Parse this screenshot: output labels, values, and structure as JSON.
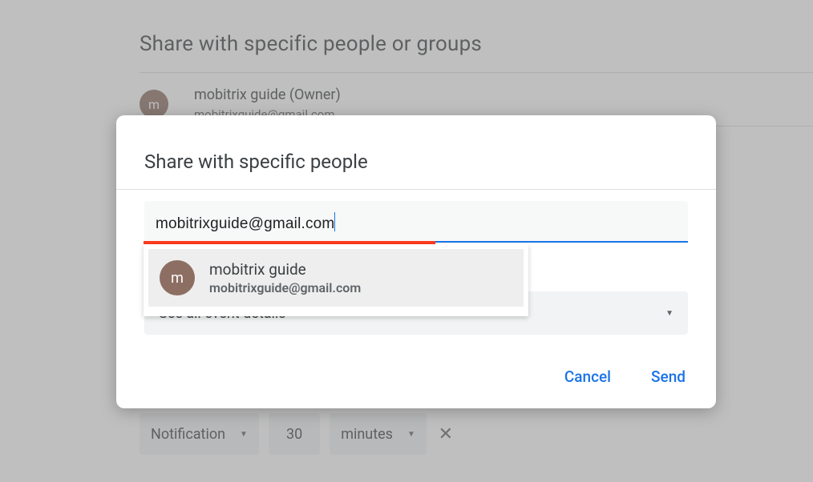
{
  "background": {
    "title": "Share with specific people or groups",
    "owner": {
      "avatar_letter": "m",
      "name": "mobitrix guide (Owner)",
      "email": "mobitrixguide@gmail.com"
    },
    "notification_row": {
      "type_label": "Notification",
      "value": "30",
      "unit_label": "minutes"
    }
  },
  "dialog": {
    "title": "Share with specific people",
    "input_value": "mobitrixguide@gmail.com",
    "suggestion": {
      "avatar_letter": "m",
      "name": "mobitrix guide",
      "email": "mobitrixguide@gmail.com"
    },
    "permission_label": "See all event details",
    "cancel_label": "Cancel",
    "send_label": "Send"
  }
}
